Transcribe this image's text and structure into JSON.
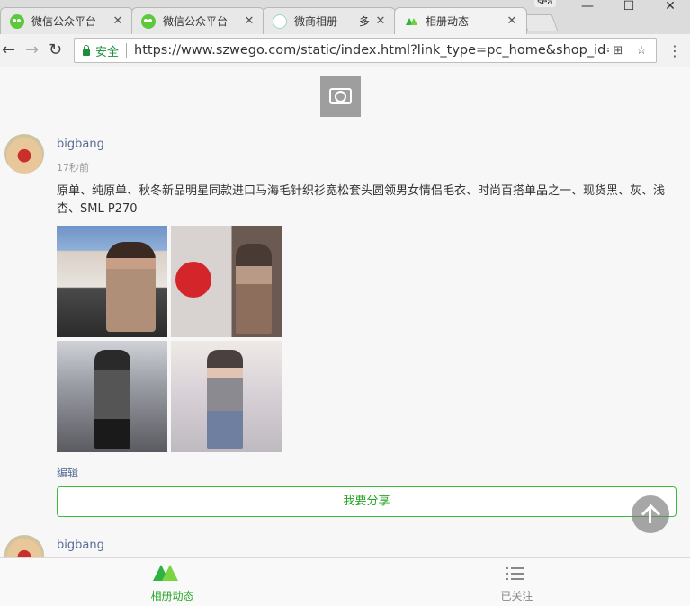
{
  "browser": {
    "tabs": [
      {
        "label": "微信公众平台",
        "icon": "wechat-icon"
      },
      {
        "label": "微信公众平台",
        "icon": "wechat-icon"
      },
      {
        "label": "微商相册——多",
        "icon": "weishang-icon"
      },
      {
        "label": "相册动态",
        "icon": "album-icon"
      }
    ],
    "profile_name": "sea",
    "security_label": "安全",
    "url": "https://www.szwego.com/static/index.html?link_type=pc_home&shop_id=A..."
  },
  "posts": [
    {
      "username": "bigbang",
      "time": "17秒前",
      "description": "原单、纯原单、秋冬新品明星同款进口马海毛针织衫宽松套头圆领男女情侣毛衣、时尚百搭单品之一、现货黑、灰、浅杏、SML P270",
      "edit_label": "编辑",
      "share_label": "我要分享"
    },
    {
      "username": "bigbang"
    }
  ],
  "bottom_nav": {
    "items": [
      {
        "label": "相册动态",
        "active": true,
        "color": "#28a528"
      },
      {
        "label": "已关注",
        "active": false,
        "color": "#888888"
      }
    ]
  },
  "colors": {
    "accent_green": "#28a528",
    "link_blue": "#576b95"
  }
}
